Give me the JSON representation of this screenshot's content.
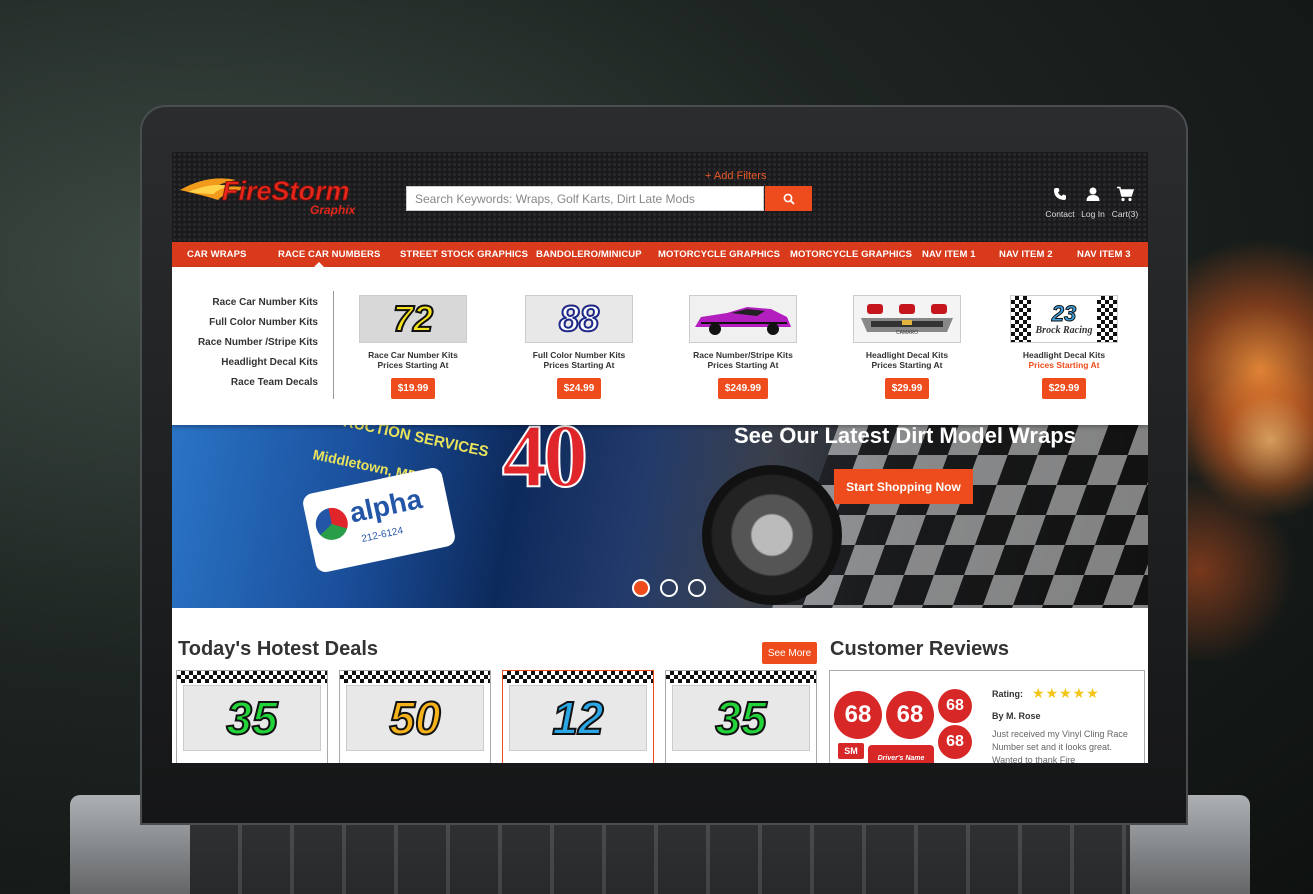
{
  "header": {
    "logo_text": "FireStorm",
    "logo_sub": "Graphix",
    "add_filters": "+ Add Filters",
    "search_placeholder": "Search Keywords: Wraps, Golf Karts, Dirt Late Mods",
    "icons": [
      {
        "name": "phone-icon",
        "label": "Contact"
      },
      {
        "name": "user-icon",
        "label": "Log In"
      },
      {
        "name": "cart-icon",
        "label": "Cart(3)"
      }
    ]
  },
  "nav": {
    "items": [
      "CAR WRAPS",
      "RACE CAR NUMBERS",
      "STREET STOCK GRAPHICS",
      "BANDOLERO/MINICUP",
      "MOTORCYCLE GRAPHICS",
      "MOTORCYCLE GRAPHICS",
      "NAV ITEM 1",
      "NAV ITEM 2",
      "NAV ITEM 3"
    ]
  },
  "mega_menu": {
    "links": [
      "Race Car Number Kits",
      "Full Color Number Kits",
      "Race Number /Stripe Kits",
      "Headlight Decal Kits",
      "Race Team Decals"
    ],
    "products": [
      {
        "name": "Race Car Number Kits",
        "sub": "Prices Starting At",
        "price": "$19.99",
        "thumb": "72"
      },
      {
        "name": "Full Color Number Kits",
        "sub": "Prices Starting At",
        "price": "$24.99",
        "thumb": "88"
      },
      {
        "name": "Race Number/Stripe Kits",
        "sub": "Prices Starting At",
        "price": "$249.99",
        "thumb": ""
      },
      {
        "name": "Headlight Decal Kits",
        "sub": "Prices Starting At",
        "price": "$29.99",
        "thumb": "CAMARO"
      },
      {
        "name": "Headlight Decal Kits",
        "sub": "Prices Starting At",
        "price": "$29.99",
        "thumb": "23",
        "thumb_sub": "Brock Racing"
      }
    ]
  },
  "hero": {
    "title": "See Our Latest Dirt Model Wraps",
    "cta": "Start Shopping Now",
    "car_number": "40",
    "car_text_1": "CONSTRUCTION SERVICES",
    "car_text_2": "Middletown, MD",
    "badge_brand": "alpha",
    "badge_phone": "212-6124"
  },
  "deals": {
    "title": "Today's Hotest Deals",
    "see_more": "See More",
    "items": [
      {
        "number": "35",
        "color": "#22d33a"
      },
      {
        "number": "50",
        "color": "#f5b21a"
      },
      {
        "number": "12",
        "color": "#2ca7e6"
      },
      {
        "number": "35",
        "color": "#22d33a"
      }
    ]
  },
  "reviews": {
    "title": "Customer Reviews",
    "rating_label": "Rating:",
    "stars": "★★★★★",
    "author": "By M. Rose",
    "body": "Just received my Vinyl Cling Race Number set and it looks great. Wanted to thank Fire",
    "decal_numbers": [
      "68",
      "68",
      "68",
      "68"
    ],
    "decal_small": "SM",
    "decal_caption": "Driver's Name"
  },
  "colors": {
    "accent": "#ee4c1c",
    "nav_bg": "#d93a1c",
    "header_bg": "#1c1c1e"
  }
}
